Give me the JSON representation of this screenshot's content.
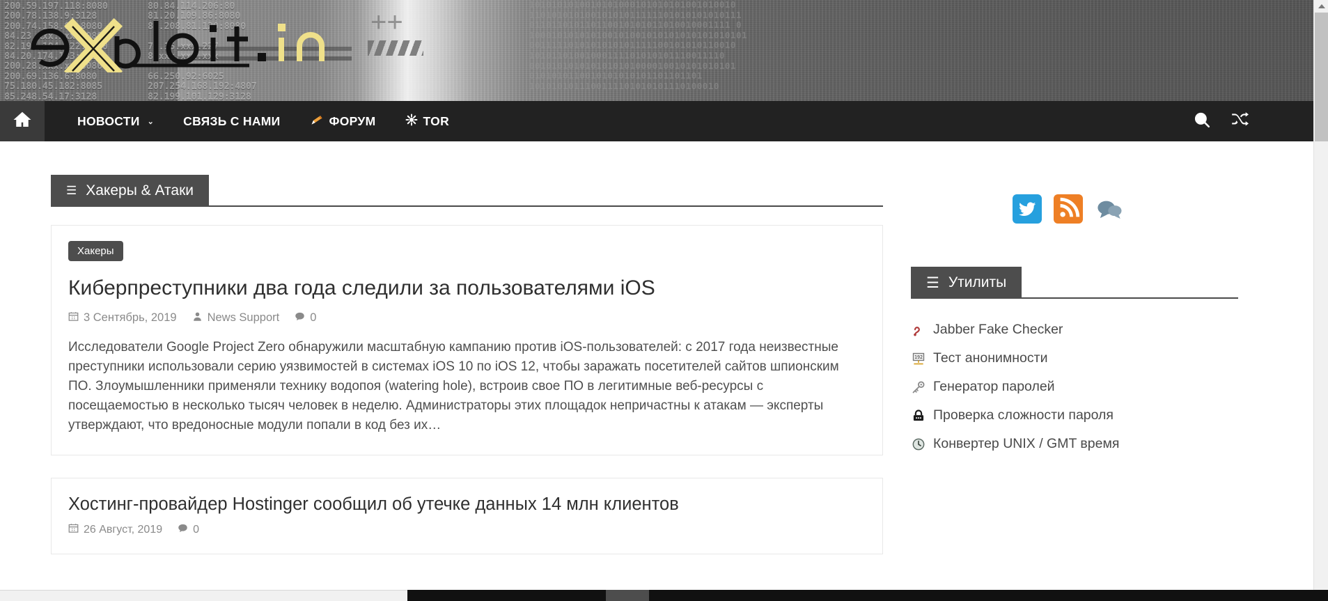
{
  "site": {
    "logo_text": "exploit.in",
    "banner_ip_column_1": "200.59.197.118:8080\n200.78.138.9:3128\n200.74.158.86:8080\n84.23.xxx.xxx:8080\n82.199.104.122:8080\n84.20.174.133:3128\n200.28.xxx.xx:8080\n200.69.136.6:8080\n75.180.45.182:8085\n85.248.54.17:3128",
    "banner_ip_column_2": "80.84.114.206:80\n81.20.109.86:8080\n82.208.81.120:8080\n\n79.15.xxx.227\n8.xxx.xxx.xxx\n\n66.250.92:6025\n207.254.168.192:4807\n82.199.101.129:3128",
    "banner_highlight_ip": "200.78.138.9:3128",
    "banner_binary": "1010101010010101000101010101001010010\n11010101010010101011111101010101010111\n011011010110110010101011010010001111 0\n100010101010100101001010101010101010101\n0011111010101010101111100101010110010\n10101101001000111101010101110011110\n0010101010101010101000010010101010101\n0101010110010101010101101101101\n1010101011100111101010101110100010"
  },
  "nav": {
    "home_label": "Главная",
    "items": [
      {
        "label": "НОВОСТИ",
        "has_dropdown": true,
        "icon": null
      },
      {
        "label": "СВЯЗЬ С НАМИ",
        "has_dropdown": false,
        "icon": null
      },
      {
        "label": "ФОРУМ",
        "has_dropdown": false,
        "icon": "pencil-icon"
      },
      {
        "label": "TOR",
        "has_dropdown": false,
        "icon": "asterisk-icon"
      }
    ],
    "search_label": "Поиск",
    "random_label": "Случайная статья"
  },
  "main": {
    "section_title": "Хакеры & Атаки",
    "articles": [
      {
        "tag": "Хакеры",
        "title": "Киберпреступники два года следили за пользователями iOS",
        "date": "3 Сентябрь, 2019",
        "author": "News Support",
        "comments": "0",
        "excerpt": "Исследователи Google Project Zero обнаружили масштабную кампанию против iOS-пользователей: с 2017 года неизвестные преступники использовали серию уязвимостей в системах iOS 10 по iOS 12, чтобы заражать посетителей сайтов шпионским ПО. Злоумышленники применяли технику водопоя (watering hole), встроив свое ПО в легитимные веб-ресурсы с посещаемостью в несколько тысяч человек в неделю. Администраторы этих площадок непричастны к атакам — эксперты утверждают, что вредоносные модули попали в код без их…"
      },
      {
        "tag": null,
        "title": "Хостинг-провайдер Hostinger сообщил об утечке данных 14 млн клиентов",
        "date": "26 Август, 2019",
        "author": null,
        "comments": "0",
        "excerpt": null
      }
    ]
  },
  "sidebar": {
    "social": [
      {
        "name": "twitter",
        "color": "#26A0DE"
      },
      {
        "name": "rss",
        "color": "#EE7F25"
      },
      {
        "name": "comments",
        "color": "#6E8CA0"
      }
    ],
    "utilities_title": "Утилиты",
    "utilities": [
      {
        "label": "Jabber Fake Checker",
        "icon": "jabber-icon"
      },
      {
        "label": "Тест анонимности",
        "icon": "ip-badge-icon"
      },
      {
        "label": "Генератор паролей",
        "icon": "key-icon"
      },
      {
        "label": "Проверка сложности пароля",
        "icon": "lock-icon"
      },
      {
        "label": "Конвертер UNIX / GMT время",
        "icon": "clock-icon"
      }
    ]
  },
  "colors": {
    "nav_bg": "#222222",
    "heading_bg": "#4d4d4d",
    "accent_logo": "#EFE08A",
    "text": "#4f4f4f"
  }
}
